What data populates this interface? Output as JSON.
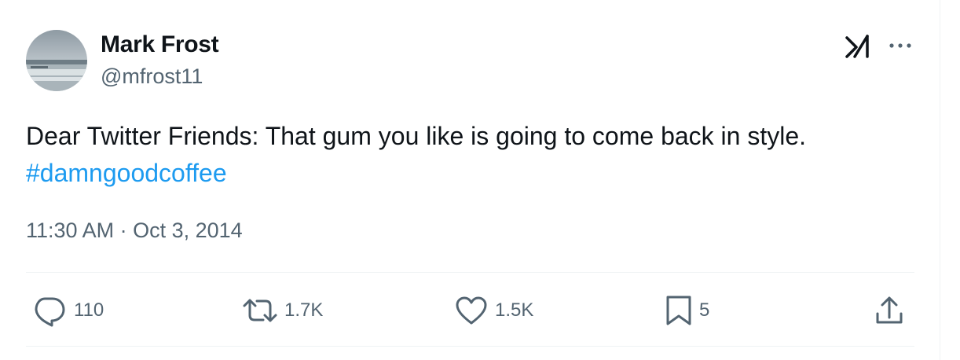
{
  "author": {
    "name": "Mark Frost",
    "handle": "@mfrost11"
  },
  "tweet": {
    "text": "Dear Twitter Friends: That gum you like is going to come back in style.",
    "hashtag": "#damngoodcoffee",
    "timestamp": "11:30 AM · Oct 3, 2014"
  },
  "actions": {
    "replies": "110",
    "reposts": "1.7K",
    "likes": "1.5K",
    "bookmarks": "5"
  },
  "icons": {
    "header_right": [
      "grok-icon",
      "more-icon"
    ],
    "actions": [
      "reply-icon",
      "repost-icon",
      "like-icon",
      "bookmark-icon",
      "share-icon"
    ]
  },
  "colors": {
    "text": "#0f1419",
    "secondary": "#536471",
    "link": "#1d9bf0",
    "divider": "#eff3f4"
  }
}
